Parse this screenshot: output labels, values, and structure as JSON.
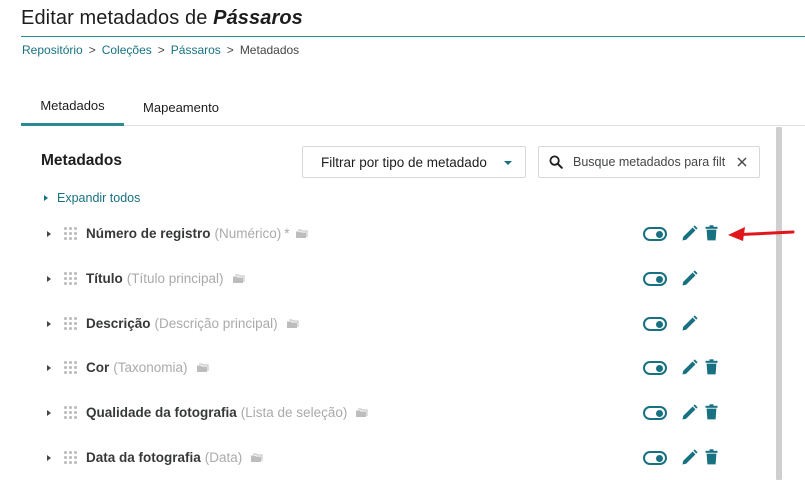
{
  "header": {
    "title_prefix": "Editar metadados de ",
    "title_collection": "Pássaros"
  },
  "breadcrumb": {
    "items": [
      "Repositório",
      "Coleções",
      "Pássaros"
    ],
    "current": "Metadados",
    "separator": ">"
  },
  "tabs": [
    {
      "label": "Metadados",
      "active": true
    },
    {
      "label": "Mapeamento",
      "active": false
    }
  ],
  "toolbar": {
    "section_title": "Metadados",
    "filter_label": "Filtrar por tipo de metadado",
    "search_placeholder": "Busque metadados para filtrar",
    "expand_all_label": "Expandir todos"
  },
  "metadata": [
    {
      "name": "Número de registro",
      "type": "(Numérico)",
      "required_mark": "*",
      "enabled": true,
      "deletable": true
    },
    {
      "name": "Título",
      "type": "(Título principal)",
      "required_mark": "",
      "enabled": true,
      "deletable": false
    },
    {
      "name": "Descrição",
      "type": "(Descrição principal)",
      "required_mark": "",
      "enabled": true,
      "deletable": false
    },
    {
      "name": "Cor",
      "type": "(Taxonomia)",
      "required_mark": "",
      "enabled": true,
      "deletable": true
    },
    {
      "name": "Qualidade da fotografia",
      "type": "(Lista de seleção)",
      "required_mark": "",
      "enabled": true,
      "deletable": true
    },
    {
      "name": "Data da fotografia",
      "type": "(Data)",
      "required_mark": "",
      "enabled": true,
      "deletable": true
    }
  ],
  "colors": {
    "accent": "#187181",
    "annotation_arrow": "#e0161b"
  }
}
